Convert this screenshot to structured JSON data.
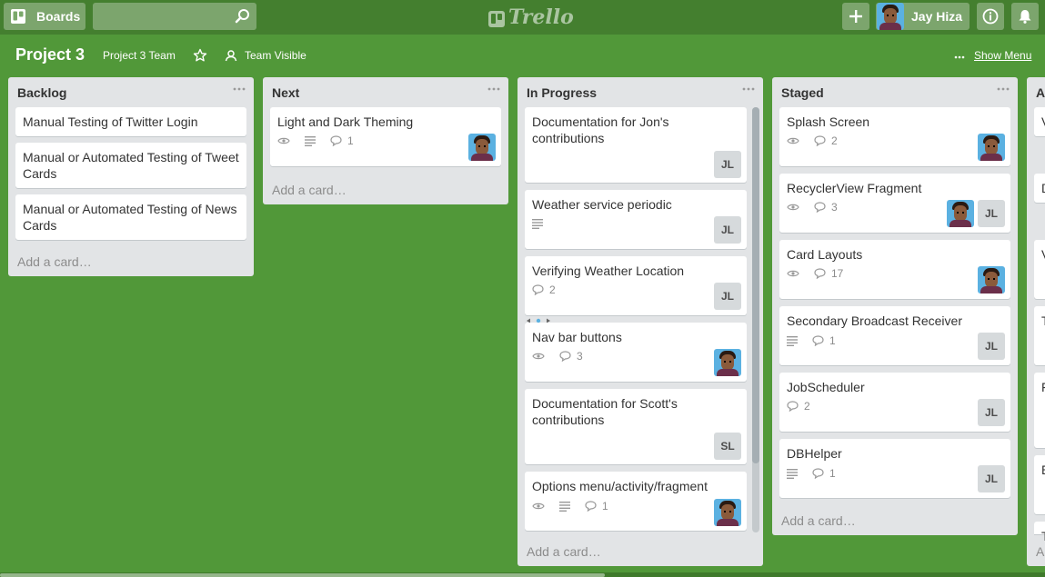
{
  "header": {
    "boards_label": "Boards",
    "search_placeholder": "",
    "logo_text": "Trello",
    "user_name": "Jay Hiza"
  },
  "board": {
    "title": "Project 3",
    "team": "Project 3 Team",
    "visibility": "Team Visible",
    "show_menu": "Show Menu"
  },
  "add_card_label": "Add a card…",
  "lists": [
    {
      "title": "Backlog",
      "cards": [
        {
          "title": "Manual Testing of Twitter Login"
        },
        {
          "title": "Manual or Automated Testing of Tweet Cards"
        },
        {
          "title": "Manual or Automated Testing of News Cards"
        }
      ]
    },
    {
      "title": "Next",
      "cards": [
        {
          "title": "Light and Dark Theming",
          "watch": true,
          "description": true,
          "comments": "1",
          "members": [
            "avatar"
          ]
        }
      ]
    },
    {
      "title": "In Progress",
      "cards": [
        {
          "title": "Documentation for Jon's contributions",
          "members": [
            "JL"
          ]
        },
        {
          "title": "Weather service periodic",
          "description": true,
          "members": [
            "JL"
          ]
        },
        {
          "title": "Verifying Weather Location",
          "comments": "2",
          "members": [
            "JL"
          ]
        },
        {
          "title": "Nav bar buttons",
          "watch": true,
          "comments": "3",
          "members": [
            "avatar"
          ]
        },
        {
          "title": "Documentation for Scott's contributions",
          "members": [
            "SL"
          ]
        },
        {
          "title": "Options menu/activity/fragment",
          "watch": true,
          "description": true,
          "comments": "1",
          "members": [
            "avatar"
          ]
        }
      ]
    },
    {
      "title": "Staged",
      "cards": [
        {
          "title": "Splash Screen",
          "watch": true,
          "comments": "2",
          "members": [
            "avatar"
          ]
        },
        {
          "title": "RecyclerView Fragment",
          "watch": true,
          "comments": "3",
          "members": [
            "avatar",
            "JL"
          ]
        },
        {
          "title": "Card Layouts",
          "watch": true,
          "comments": "17",
          "members": [
            "avatar"
          ]
        },
        {
          "title": "Secondary Broadcast Receiver",
          "description": true,
          "comments": "1",
          "members": [
            "JL"
          ]
        },
        {
          "title": "JobScheduler",
          "comments": "2",
          "members": [
            "JL"
          ]
        },
        {
          "title": "DBHelper",
          "description": true,
          "comments": "1",
          "members": [
            "JL"
          ]
        }
      ]
    },
    {
      "title": "A",
      "partial_card_letters": [
        "V",
        "D",
        "V",
        "T",
        "F",
        "E",
        "T"
      ],
      "add_card_partial": "A"
    }
  ],
  "colors": {
    "board_bg": "#519839",
    "header_bg": "#447f2f",
    "list_bg": "#e2e4e6",
    "card_bg": "#ffffff",
    "member_bg": "#d6dadc"
  }
}
